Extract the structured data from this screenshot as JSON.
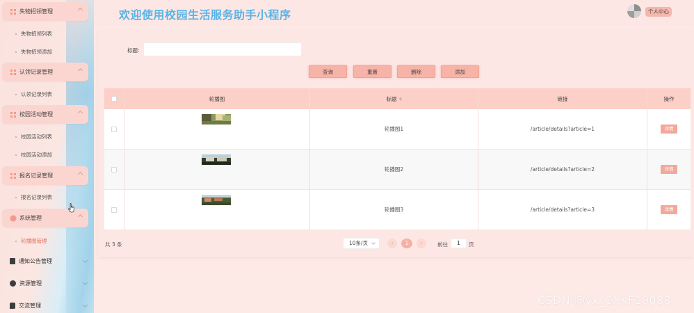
{
  "header": {
    "title": "欢迎使用校园生活服务助手小程序",
    "user_center": "个人中心"
  },
  "sidebar": {
    "groups": [
      {
        "label": "失物招领管理",
        "items": [
          "失物招领列表",
          "失物招领添加"
        ]
      },
      {
        "label": "认领记录管理",
        "items": [
          "认领记录列表"
        ]
      },
      {
        "label": "校园活动管理",
        "items": [
          "校园活动列表",
          "校园活动添加"
        ]
      },
      {
        "label": "报名记录管理",
        "items": [
          "报名记录列表"
        ]
      },
      {
        "label": "系统管理",
        "items": [
          "轮播图管理"
        ]
      }
    ],
    "top_items": [
      "通知公告管理",
      "资源管理",
      "交流管理"
    ]
  },
  "search": {
    "label": "标题:",
    "value": "",
    "placeholder": ""
  },
  "buttons": {
    "query": "查询",
    "reset": "重置",
    "delete": "删除",
    "add": "添加"
  },
  "table": {
    "columns": [
      "轮播图",
      "标题",
      "链接",
      "操作"
    ],
    "rows": [
      {
        "title": "轮播图1",
        "link": "/article/details?article=1",
        "action": "详情"
      },
      {
        "title": "轮播图2",
        "link": "/article/details?article=2",
        "action": "详情"
      },
      {
        "title": "轮播图3",
        "link": "/article/details?article=3",
        "action": "详情"
      }
    ]
  },
  "pagination": {
    "total": "共 3 条",
    "page_size": "10条/页",
    "prev": "‹",
    "current": "1",
    "next": "›",
    "goto_label": "前往",
    "goto_value": "1",
    "goto_suffix": "页"
  },
  "watermark": "CSDN @vx_CXKF10088",
  "colors": {
    "accent": "#f6b0a4",
    "title": "#58b4e6",
    "active_menu": "#e2725b"
  }
}
